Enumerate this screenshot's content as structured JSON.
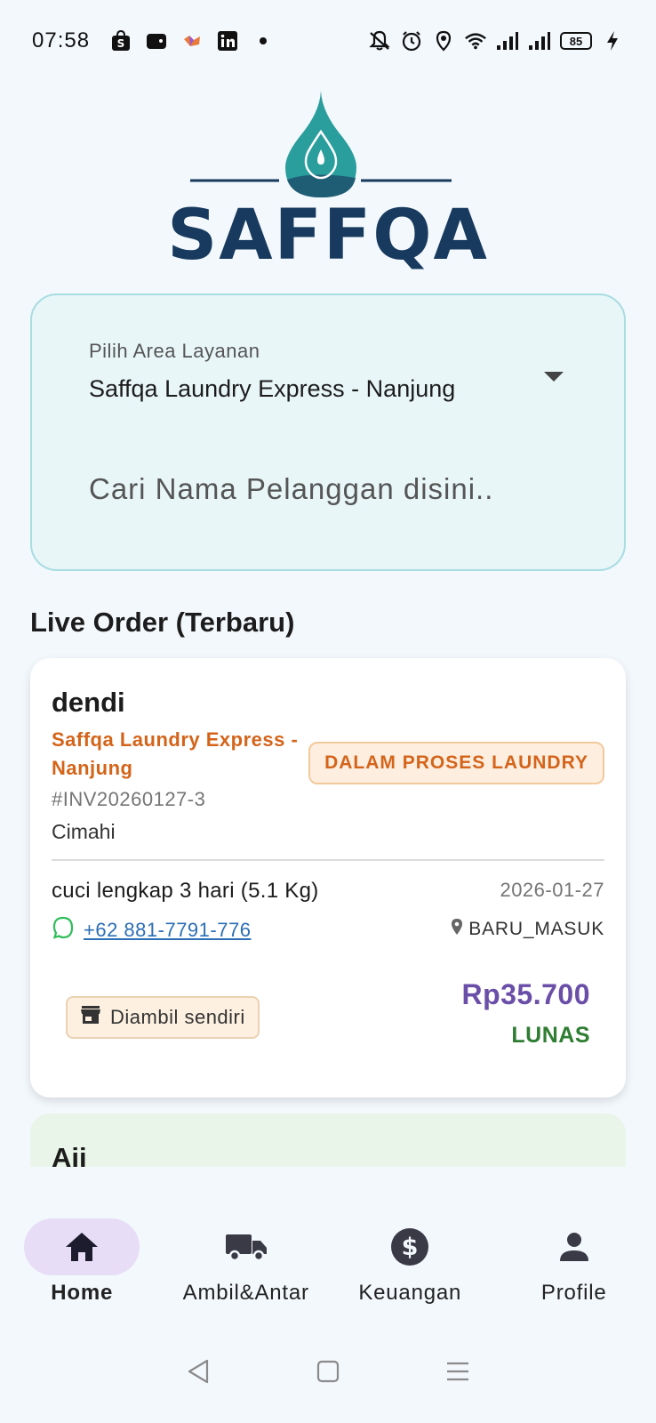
{
  "status_bar": {
    "time": "07:58",
    "left_icons": [
      "shopee-icon",
      "wallet-icon",
      "game-icon",
      "linkedin-icon",
      "dot-icon"
    ],
    "right_icons": [
      "mute-icon",
      "alarm-icon",
      "location-icon",
      "wifi-icon",
      "signal-icon",
      "signal-icon",
      "battery-icon",
      "charging-icon"
    ],
    "battery": "85"
  },
  "logo": {
    "text": "SAFFQA",
    "colors": {
      "drop": "#2a9d9d",
      "text": "#173a5e"
    }
  },
  "filter": {
    "area_label": "Pilih Area Layanan",
    "area_value": "Saffqa Laundry Express - Nanjung",
    "search_placeholder": "Cari Nama Pelanggan disini.."
  },
  "section_title": "Live Order (Terbaru)",
  "orders": [
    {
      "customer": "dendi",
      "store": "Saffqa Laundry Express - Nanjung",
      "status": "DALAM PROSES LAUNDRY",
      "invoice": "#INV20260127-3",
      "city": "Cimahi",
      "service": "cuci lengkap 3 hari (5.1 Kg)",
      "date": "2026-01-27",
      "phone": "+62 881-7791-776",
      "location": "BARU_MASUK",
      "pickup": "Diambil sendiri",
      "price": "Rp35.700",
      "payment": "LUNAS"
    },
    {
      "customer": "Aji"
    }
  ],
  "nav": {
    "items": [
      {
        "label": "Home",
        "icon": "home-icon",
        "active": true
      },
      {
        "label": "Ambil&Antar",
        "icon": "truck-icon",
        "active": false
      },
      {
        "label": "Keuangan",
        "icon": "dollar-icon",
        "active": false
      },
      {
        "label": "Profile",
        "icon": "person-icon",
        "active": false
      }
    ]
  },
  "colors": {
    "accent": "#6a4ea8",
    "status_orange": "#d4641a",
    "paid_green": "#2e7d32",
    "card_bg": "#e8f6f8"
  }
}
